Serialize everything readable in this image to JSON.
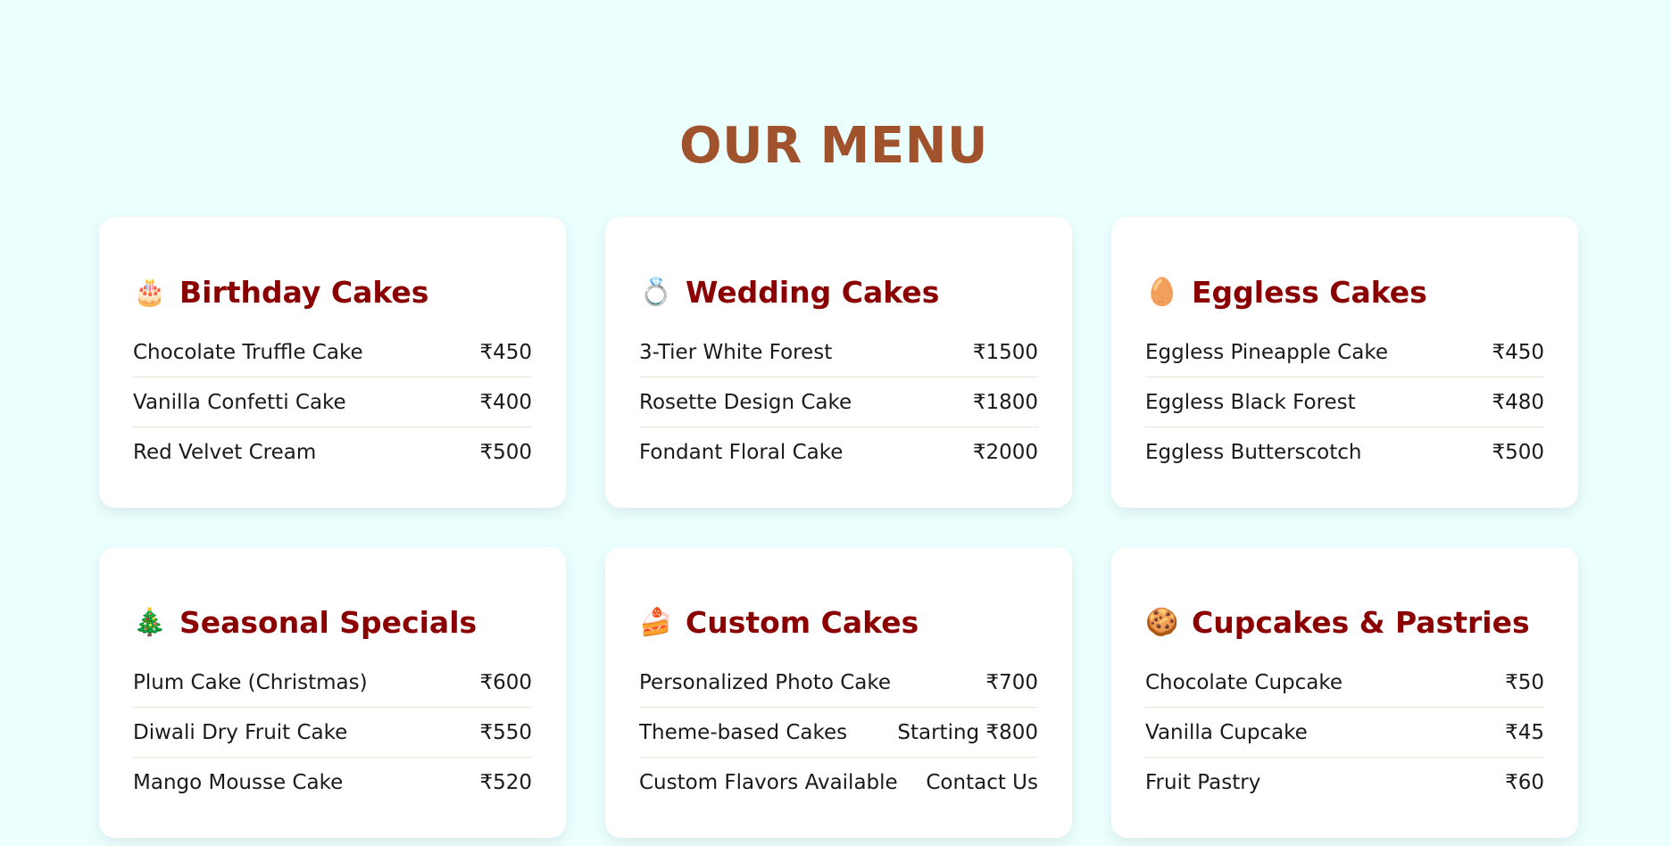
{
  "colors": {
    "page_background": "#ebffff",
    "title": "#a0522d",
    "category_heading": "#8b0000",
    "text": "#1a1a1a",
    "card_background": "#ffffff",
    "divider": "#f3e3d6"
  },
  "page_title": "OUR MENU",
  "categories": [
    {
      "icon": "birthday-cake-icon",
      "icon_glyph": "🎂",
      "title": "Birthday Cakes",
      "items": [
        {
          "name": "Chocolate Truffle Cake",
          "price": "₹450"
        },
        {
          "name": "Vanilla Confetti Cake",
          "price": "₹400"
        },
        {
          "name": "Red Velvet Cream",
          "price": "₹500"
        }
      ]
    },
    {
      "icon": "ring-icon",
      "icon_glyph": "💍",
      "title": "Wedding Cakes",
      "items": [
        {
          "name": "3-Tier White Forest",
          "price": "₹1500"
        },
        {
          "name": "Rosette Design Cake",
          "price": "₹1800"
        },
        {
          "name": "Fondant Floral Cake",
          "price": "₹2000"
        }
      ]
    },
    {
      "icon": "egg-icon",
      "icon_glyph": "🥚",
      "title": "Eggless Cakes",
      "items": [
        {
          "name": "Eggless Pineapple Cake",
          "price": "₹450"
        },
        {
          "name": "Eggless Black Forest",
          "price": "₹480"
        },
        {
          "name": "Eggless Butterscotch",
          "price": "₹500"
        }
      ]
    },
    {
      "icon": "christmas-tree-icon",
      "icon_glyph": "🎄",
      "title": "Seasonal Specials",
      "items": [
        {
          "name": "Plum Cake (Christmas)",
          "price": "₹600"
        },
        {
          "name": "Diwali Dry Fruit Cake",
          "price": "₹550"
        },
        {
          "name": "Mango Mousse Cake",
          "price": "₹520"
        }
      ]
    },
    {
      "icon": "cake-slice-icon",
      "icon_glyph": "🍰",
      "title": "Custom Cakes",
      "items": [
        {
          "name": "Personalized Photo Cake",
          "price": "₹700"
        },
        {
          "name": "Theme-based Cakes",
          "price": "Starting ₹800"
        },
        {
          "name": "Custom Flavors Available",
          "price": "Contact Us"
        }
      ]
    },
    {
      "icon": "cookie-icon",
      "icon_glyph": "🍪",
      "title": "Cupcakes & Pastries",
      "items": [
        {
          "name": "Chocolate Cupcake",
          "price": "₹50"
        },
        {
          "name": "Vanilla Cupcake",
          "price": "₹45"
        },
        {
          "name": "Fruit Pastry",
          "price": "₹60"
        }
      ]
    }
  ]
}
